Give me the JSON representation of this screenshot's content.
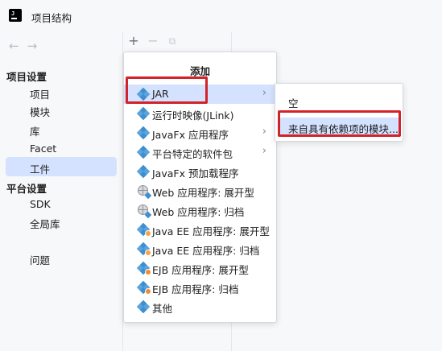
{
  "window": {
    "title": "项目结构",
    "logo_glyph": "J"
  },
  "nav": {
    "back_arrow": "←",
    "forward_arrow": "→"
  },
  "sidebar": {
    "project_settings_title": "项目设置",
    "project_settings_items": [
      "项目",
      "模块",
      "库",
      "Facet",
      "工件"
    ],
    "platform_settings_title": "平台设置",
    "platform_settings_items": [
      "SDK",
      "全局库"
    ],
    "problems": "问题",
    "selected_item": "工件"
  },
  "toolbar": {
    "add": "+",
    "remove": "−",
    "copy": "⧉"
  },
  "add_menu": {
    "header": "添加",
    "items": [
      {
        "label": "JAR",
        "icon": "module-diamond-icon",
        "has_submenu": true
      },
      {
        "label": "运行时映像(JLink)",
        "icon": "module-diamond-icon",
        "has_submenu": false
      },
      {
        "label": "JavaFx 应用程序",
        "icon": "module-diamond-icon",
        "has_submenu": true
      },
      {
        "label": "平台特定的软件包",
        "icon": "module-diamond-icon",
        "has_submenu": true
      },
      {
        "label": "JavaFx 预加载程序",
        "icon": "module-diamond-icon",
        "has_submenu": false
      },
      {
        "label": "Web 应用程序: 展开型",
        "icon": "web-globe-icon",
        "has_submenu": false
      },
      {
        "label": "Web 应用程序: 归档",
        "icon": "web-globe-icon",
        "has_submenu": false
      },
      {
        "label": "Java EE 应用程序: 展开型",
        "icon": "java-ee-icon",
        "has_submenu": false
      },
      {
        "label": "Java EE 应用程序: 归档",
        "icon": "java-ee-icon",
        "has_submenu": false
      },
      {
        "label": "EJB 应用程序: 展开型",
        "icon": "ejb-icon",
        "has_submenu": false
      },
      {
        "label": "EJB 应用程序: 归档",
        "icon": "ejb-icon",
        "has_submenu": false
      },
      {
        "label": "其他",
        "icon": "module-diamond-icon",
        "has_submenu": false
      }
    ],
    "submenu_arrow": "›"
  },
  "jar_submenu": {
    "items": [
      "空",
      "来自具有依赖项的模块..."
    ],
    "highlighted": "来自具有依赖项的模块..."
  },
  "colors": {
    "selection": "#d4e2ff",
    "annotation_red": "#d2232a",
    "icon_blue": "#3d8fcf"
  }
}
